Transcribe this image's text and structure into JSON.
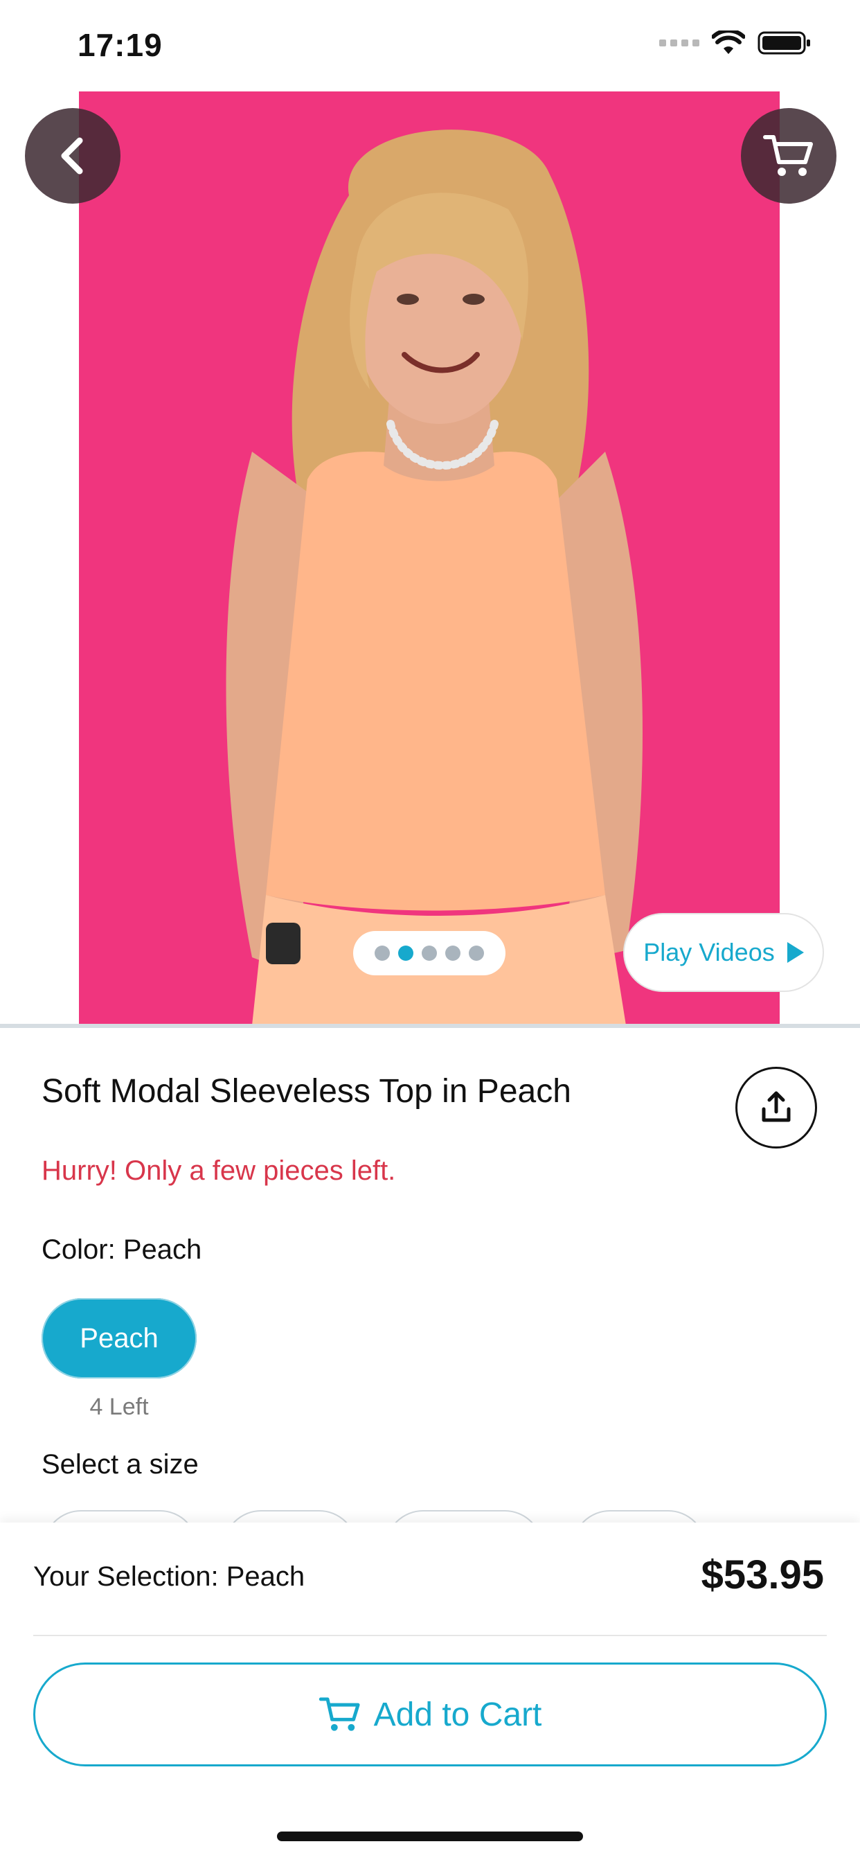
{
  "status_bar": {
    "time": "17:19"
  },
  "product": {
    "title": "Soft Modal Sleeveless Top in Peach",
    "stock_warning": "Hurry! Only a few pieces left.",
    "color_label": "Color: ",
    "color_value": "Peach",
    "color_options": [
      {
        "label": "Peach",
        "stock": "4 Left"
      }
    ],
    "size_label": "Select a size"
  },
  "gallery": {
    "image_count": 5,
    "active_index": 1,
    "play_videos_label": "Play Videos"
  },
  "footer": {
    "selection_text": "Your Selection: Peach",
    "price": "$53.95",
    "add_to_cart_label": "Add to Cart"
  },
  "colors": {
    "accent": "#17a9cd",
    "warning": "#d8364b",
    "photo_bg": "#f0357e"
  },
  "icons": [
    "back-icon",
    "cart-icon",
    "share-icon",
    "play-icon"
  ]
}
